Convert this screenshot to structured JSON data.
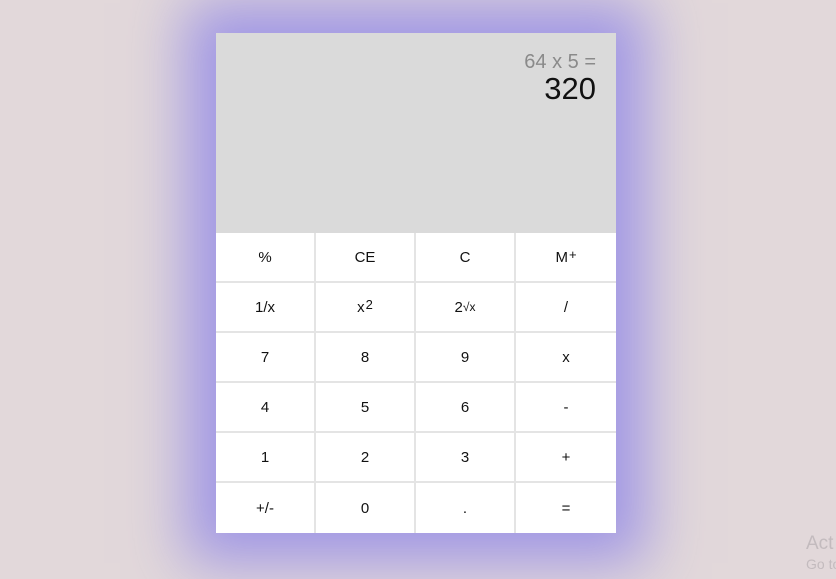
{
  "display": {
    "expression": "64 x 5 =",
    "result": "320"
  },
  "keys": [
    {
      "label": "%",
      "sup": ""
    },
    {
      "label": "CE",
      "sup": ""
    },
    {
      "label": "C",
      "sup": ""
    },
    {
      "label": "M",
      "sup": "+"
    },
    {
      "label": "1/x",
      "sup": ""
    },
    {
      "label": "x",
      "sup": "2"
    },
    {
      "label": "2",
      "sup": "",
      "small": "√x"
    },
    {
      "label": "/",
      "sup": ""
    },
    {
      "label": "7",
      "sup": ""
    },
    {
      "label": "8",
      "sup": ""
    },
    {
      "label": "9",
      "sup": ""
    },
    {
      "label": "x",
      "sup": ""
    },
    {
      "label": "4",
      "sup": ""
    },
    {
      "label": "5",
      "sup": ""
    },
    {
      "label": "6",
      "sup": ""
    },
    {
      "label": "-",
      "sup": ""
    },
    {
      "label": "1",
      "sup": ""
    },
    {
      "label": "2",
      "sup": ""
    },
    {
      "label": "3",
      "sup": ""
    },
    {
      "label": "+",
      "sup": ""
    },
    {
      "label": "+/-",
      "sup": ""
    },
    {
      "label": "0",
      "sup": ""
    },
    {
      "label": ".",
      "sup": ""
    },
    {
      "label": "=",
      "sup": ""
    }
  ],
  "watermark": {
    "line1": "Act",
    "line2": "Go to"
  },
  "colors": {
    "background": "#e2d8da",
    "display": "#dadada",
    "glow": "#8a80e8",
    "key": "#ffffff"
  }
}
